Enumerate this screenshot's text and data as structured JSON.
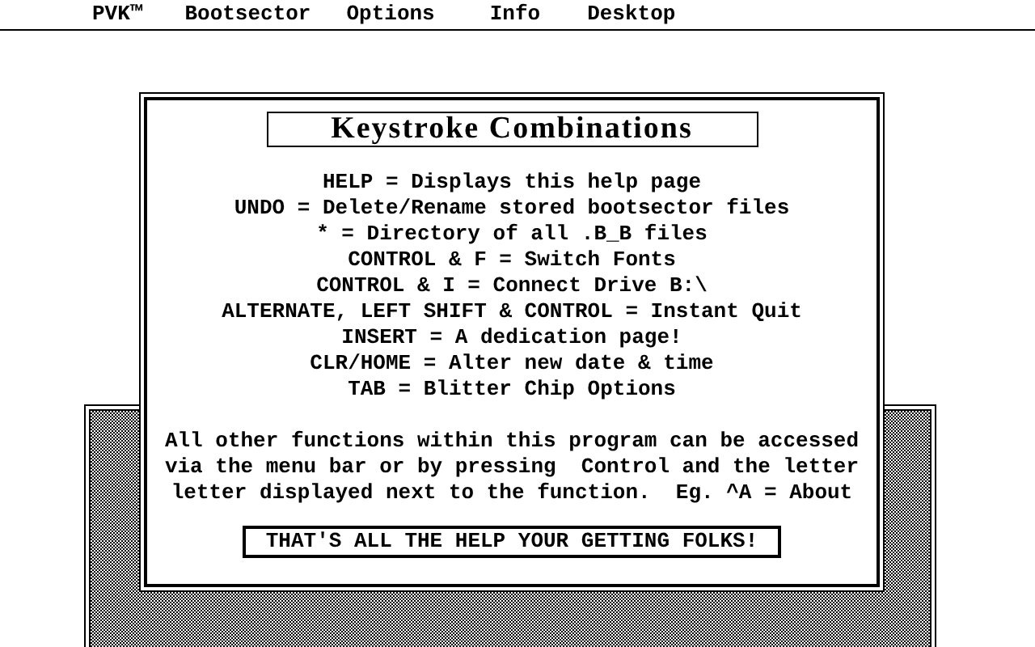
{
  "menu_bar": [
    {
      "label": "PVK™"
    },
    {
      "label": "Bootsector"
    },
    {
      "label": "Options"
    },
    {
      "label": "Info"
    },
    {
      "label": "Desktop"
    }
  ],
  "dialog": {
    "title": "Keystroke Combinations",
    "shortcuts": [
      "HELP = Displays this help page",
      "UNDO = Delete/Rename stored bootsector files",
      "* = Directory of all .B_B files",
      "CONTROL & F = Switch Fonts",
      "CONTROL & I = Connect Drive B:\\",
      "ALTERNATE, LEFT SHIFT & CONTROL = Instant Quit",
      "INSERT = A dedication page!",
      "CLR/HOME = Alter new date & time",
      "TAB = Blitter Chip Options"
    ],
    "note_lines": [
      "All other functions within this program can be accessed",
      "via the menu bar or by pressing  Control and the letter",
      "letter displayed next to the function.  Eg. ^A = About"
    ],
    "button": "THAT'S ALL THE HELP YOUR GETTING FOLKS!"
  }
}
